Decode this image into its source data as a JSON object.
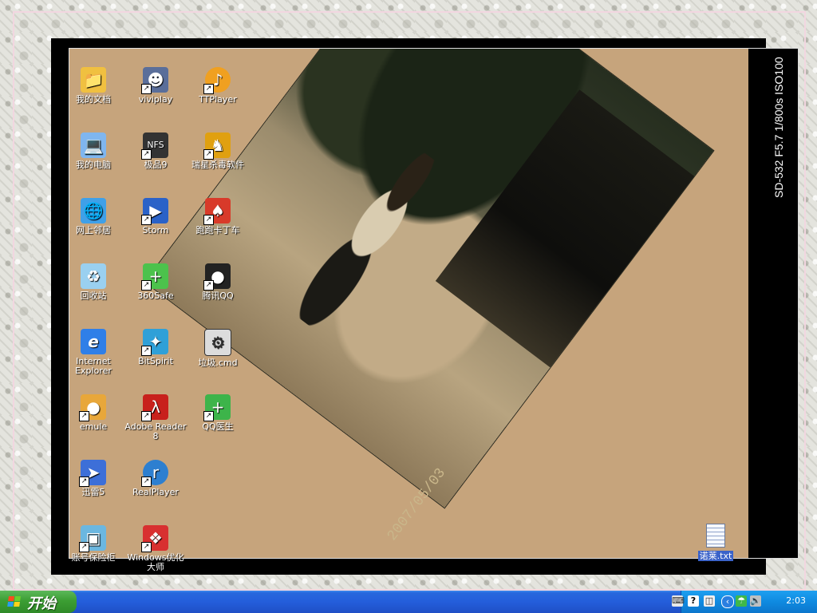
{
  "photo": {
    "exif": "SD-532 F5.7 1/800s ISO100",
    "date_stamp": "2007/05/03"
  },
  "desktop_icons": [
    {
      "label": "我的文档",
      "icon": "my-documents-icon",
      "color": "#f0c040",
      "shortcut": false
    },
    {
      "label": "我的电脑",
      "icon": "my-computer-icon",
      "color": "#7fb6ef",
      "shortcut": false
    },
    {
      "label": "网上邻居",
      "icon": "network-places-icon",
      "color": "#3fa0e8",
      "shortcut": false
    },
    {
      "label": "回收站",
      "icon": "recycle-bin-icon",
      "color": "#9ad0f0",
      "shortcut": false
    },
    {
      "label": "Internet Explorer",
      "icon": "internet-explorer-icon",
      "color": "#2f7fe8",
      "shortcut": false
    },
    {
      "label": "emule",
      "icon": "emule-icon",
      "color": "#e8a73a",
      "shortcut": true
    },
    {
      "label": "迅雷5",
      "icon": "thunder-icon",
      "color": "#3d6fd8",
      "shortcut": true
    },
    {
      "label": "账号保险柜",
      "icon": "account-safe-icon",
      "color": "#6bb7e0",
      "shortcut": true
    },
    {
      "label": "viviplay",
      "icon": "viviplay-icon",
      "color": "#5a6e9a",
      "shortcut": true
    },
    {
      "label": "极品9",
      "icon": "nfs-icon",
      "color": "#333333",
      "shortcut": true
    },
    {
      "label": "Storm",
      "icon": "storm-icon",
      "color": "#2a62c8",
      "shortcut": true
    },
    {
      "label": "360Safe",
      "icon": "360safe-icon",
      "color": "#4cc24c",
      "shortcut": true
    },
    {
      "label": "BitSpirit",
      "icon": "bitspirit-icon",
      "color": "#2fa0d8",
      "shortcut": true
    },
    {
      "label": "Adobe Reader 8",
      "icon": "adobe-reader-icon",
      "color": "#c8201c",
      "shortcut": true
    },
    {
      "label": "RealPlayer",
      "icon": "realplayer-icon",
      "color": "#2d7fd0",
      "shortcut": true
    },
    {
      "label": "Windows优化大师",
      "icon": "windows-master-icon",
      "color": "#d83030",
      "shortcut": true
    },
    {
      "label": "TTPlayer",
      "icon": "ttplayer-icon",
      "color": "#f0a020",
      "shortcut": true
    },
    {
      "label": "瑞星杀毒软件",
      "icon": "rising-antivirus-icon",
      "color": "#e0a010",
      "shortcut": true
    },
    {
      "label": "跑跑卡丁车",
      "icon": "kartrider-icon",
      "color": "#d83a2a",
      "shortcut": true
    },
    {
      "label": "腾讯QQ",
      "icon": "qq-icon",
      "color": "#222222",
      "shortcut": true
    },
    {
      "label": "垃圾.cmd",
      "icon": "cmd-file-icon",
      "color": "#dcdcdc",
      "shortcut": false
    },
    {
      "label": "QQ医生",
      "icon": "qq-doctor-icon",
      "color": "#3db44a",
      "shortcut": true
    }
  ],
  "desktop_file": {
    "label": "诺莱.txt",
    "icon": "text-file-icon"
  },
  "taskbar": {
    "start_label": "开始",
    "clock": "2:03",
    "tray_icons": [
      "keyboard-icon",
      "help-icon",
      "network-icon",
      "back-arrow-icon",
      "umbrella-icon",
      "speaker-icon"
    ]
  },
  "colors": {
    "taskbar": "#245edb",
    "start": "#3c9e33",
    "tray": "#0f8ae0",
    "photo_background": "#c6a47c"
  }
}
